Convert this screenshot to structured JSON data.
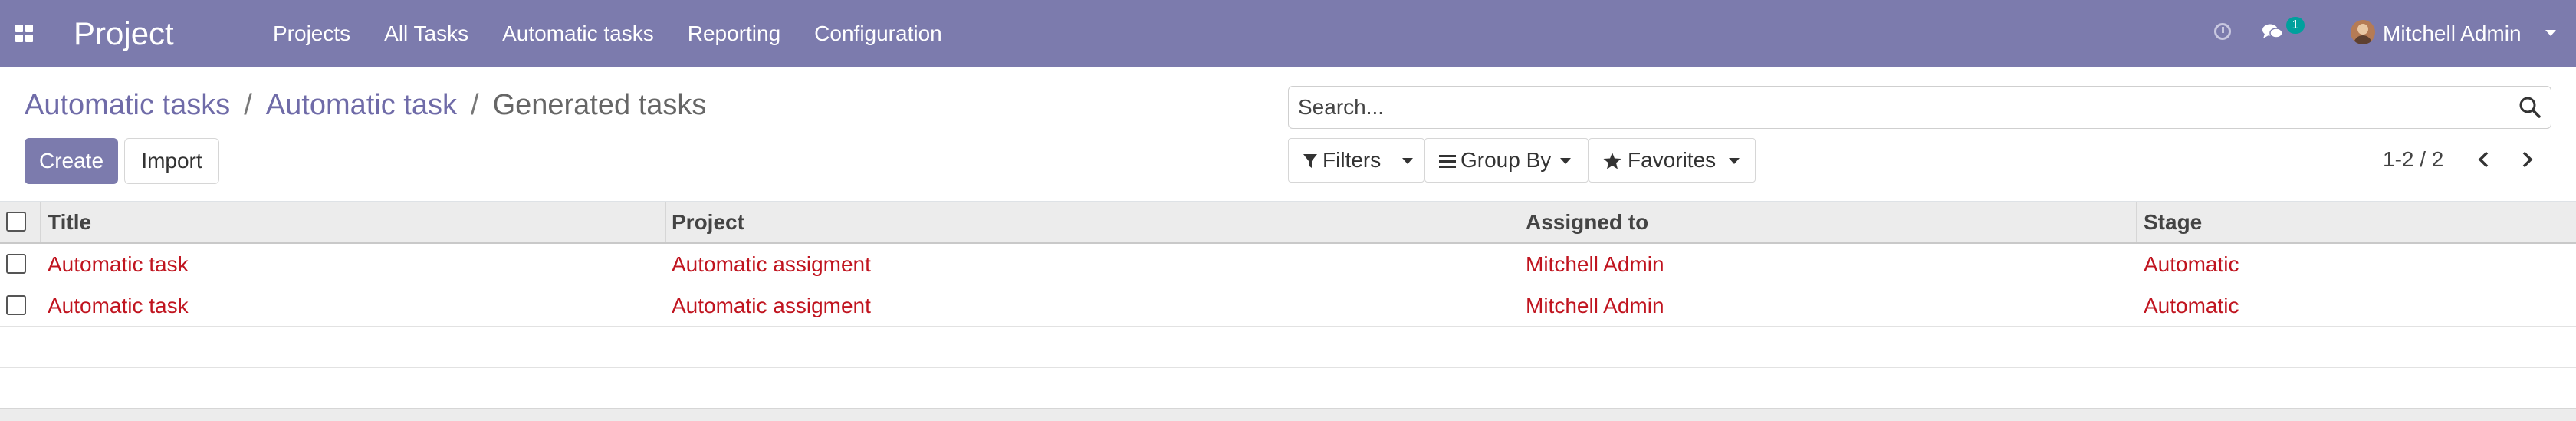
{
  "navbar": {
    "app_name": "Project",
    "menu": [
      "Projects",
      "All Tasks",
      "Automatic tasks",
      "Reporting",
      "Configuration"
    ],
    "chat_count": "1",
    "user_name": "Mitchell Admin"
  },
  "breadcrumb": {
    "items": [
      "Automatic tasks",
      "Automatic task"
    ],
    "separator": "/",
    "current": "Generated tasks"
  },
  "actions": {
    "create_label": "Create",
    "import_label": "Import"
  },
  "search": {
    "placeholder": "Search..."
  },
  "filters": {
    "filters_label": "Filters",
    "group_by_label": "Group By",
    "favorites_label": "Favorites"
  },
  "pager": {
    "value": "1-2 / 2"
  },
  "table": {
    "columns": [
      "Title",
      "Project",
      "Assigned to",
      "Stage"
    ],
    "rows": [
      [
        "Automatic task",
        "Automatic assigment",
        "Mitchell Admin",
        "Automatic"
      ],
      [
        "Automatic task",
        "Automatic assigment",
        "Mitchell Admin",
        "Automatic"
      ]
    ]
  },
  "colors": {
    "navbar": "#7c7bad",
    "link": "#c0141f",
    "breadcrumb_link": "#6f6ba8",
    "badge": "#00a09d"
  },
  "icons": [
    "apps-grid-icon",
    "clock-icon",
    "chat-icon",
    "search-icon",
    "filter-icon",
    "group-by-icon",
    "star-icon",
    "chevron-left-icon",
    "chevron-right-icon"
  ]
}
